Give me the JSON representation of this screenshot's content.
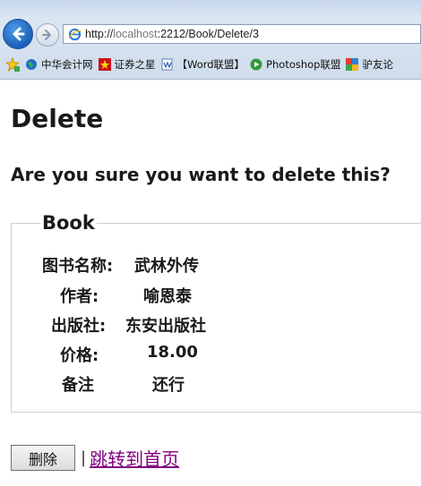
{
  "browser": {
    "url_prefix": "http://",
    "url_host": "localhost",
    "url_rest": ":2212/Book/Delete/3",
    "favorites": [
      {
        "label": "中华会计网",
        "icon": "globe-icon"
      },
      {
        "label": "证券之星",
        "icon": "star-logo-icon"
      },
      {
        "label": "【Word联盟】",
        "icon": "word-page-icon"
      },
      {
        "label": "Photoshop联盟",
        "icon": "play-circle-icon"
      },
      {
        "label": "驴友论",
        "icon": "grid-logo-icon"
      }
    ]
  },
  "page": {
    "title": "Delete",
    "confirm_question": "Are you sure you want to delete this?"
  },
  "book": {
    "legend": "Book",
    "fields": [
      {
        "label": "图书名称:",
        "value": "武林外传"
      },
      {
        "label": "作者:",
        "value": "喻恩泰"
      },
      {
        "label": "出版社:",
        "value": "东安出版社"
      },
      {
        "label": "价格:",
        "value": "18.00"
      },
      {
        "label": "备注",
        "value": "还行"
      }
    ]
  },
  "actions": {
    "delete_label": "删除",
    "separator": "|",
    "home_link": "跳转到首页"
  }
}
